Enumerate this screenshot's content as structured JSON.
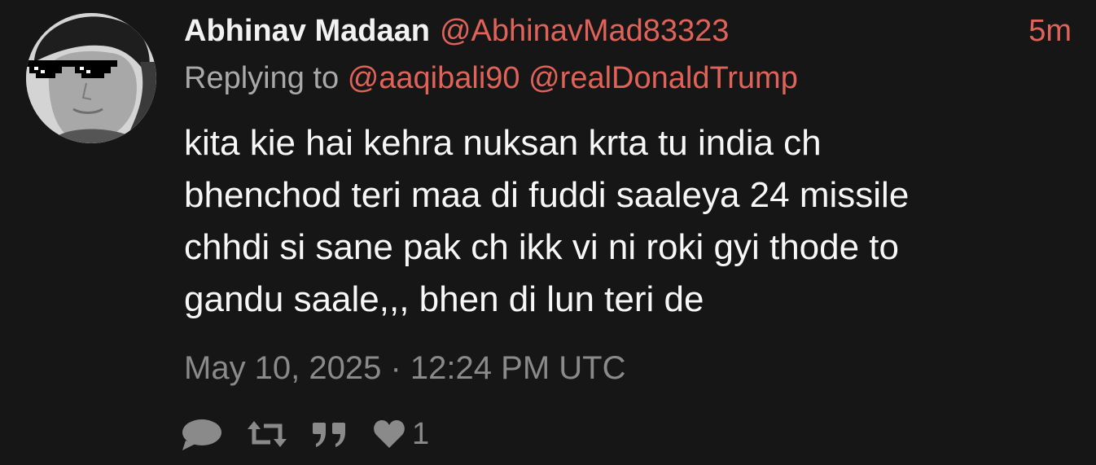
{
  "tweet": {
    "fullname": "Abhinav Madaan",
    "username": "@AbhinavMad83323",
    "time_ago": "5m",
    "replying_prefix": "Replying to",
    "replying_to": [
      "@aaqibali90",
      "@realDonaldTrump"
    ],
    "content_lines": [
      "kita kie hai kehra nuksan krta tu india ch",
      "bhenchod teri maa di fuddi saaleya 24 missile",
      "chhdi si sane pak ch ikk vi ni roki gyi thode to",
      "gandu saale,,, bhen di lun teri de"
    ],
    "date": "May 10, 2025 · 12:24 PM UTC",
    "stats": {
      "replies_icon": "comment-icon",
      "retweets_icon": "retweet-icon",
      "quotes_icon": "quote-icon",
      "likes_icon": "heart-icon",
      "likes": "1"
    }
  },
  "colors": {
    "background": "#161616",
    "accent": "#e0635a",
    "muted": "#8a8a8a",
    "text": "#f2f2f2"
  }
}
